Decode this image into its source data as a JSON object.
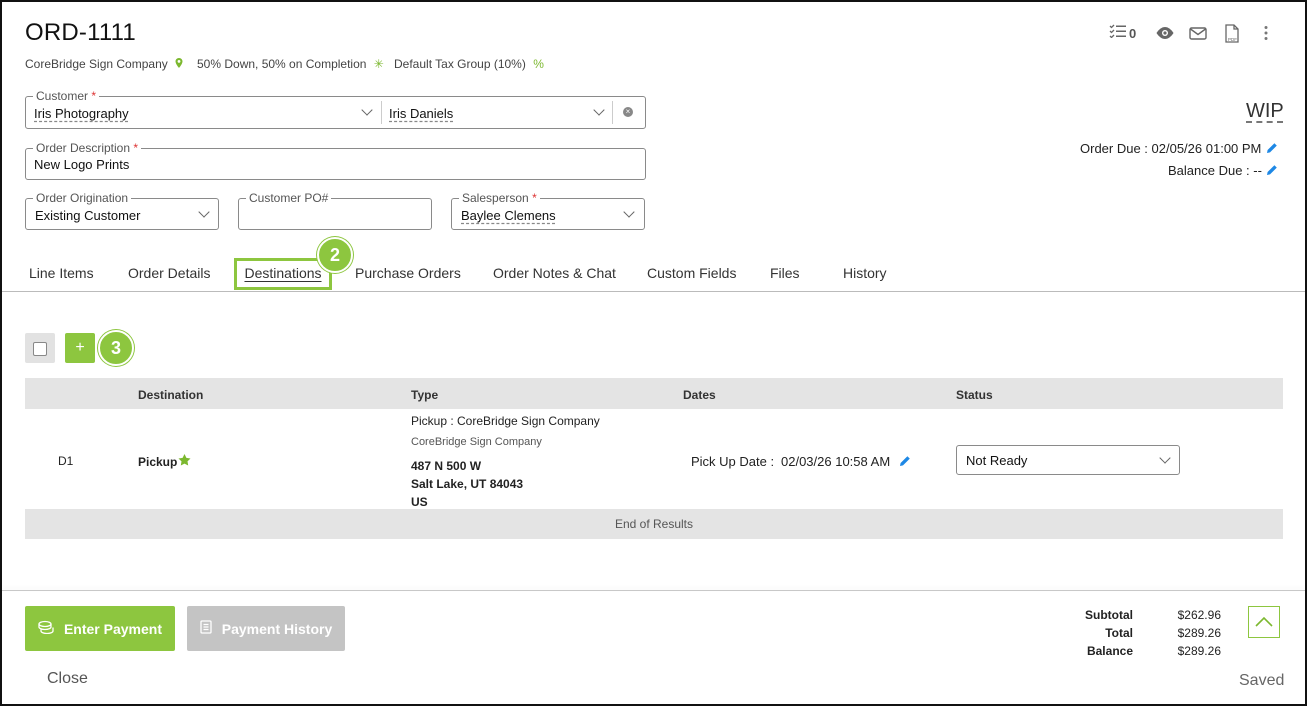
{
  "header": {
    "order_number": "ORD-1111",
    "company": "CoreBridge Sign Company",
    "payment_terms": "50% Down, 50% on Completion",
    "tax_group": "Default Tax Group (10%)",
    "task_count": "0",
    "status": "WIP",
    "order_due": "Order Due : 02/05/26 01:00 PM",
    "balance_due": "Balance Due : --"
  },
  "form": {
    "customer_label": "Customer",
    "customer_value": "Iris Photography",
    "contact_value": "Iris Daniels",
    "description_label": "Order Description",
    "description_value": "New Logo Prints",
    "origination_label": "Order Origination",
    "origination_value": "Existing Customer",
    "po_label": "Customer PO#",
    "po_value": "",
    "salesperson_label": "Salesperson",
    "salesperson_value": "Baylee Clemens",
    "required_mark": "*"
  },
  "tabs": [
    {
      "label": "Line Items"
    },
    {
      "label": "Order Details"
    },
    {
      "label": "Destinations"
    },
    {
      "label": "Purchase Orders"
    },
    {
      "label": "Order Notes & Chat"
    },
    {
      "label": "Custom Fields"
    },
    {
      "label": "Files"
    },
    {
      "label": "History"
    }
  ],
  "callouts": {
    "tab_badge": "2",
    "add_badge": "3"
  },
  "toolbar": {
    "add_label": "+"
  },
  "table": {
    "columns": [
      "Destination",
      "Type",
      "Dates",
      "Status"
    ],
    "rows": [
      {
        "id": "D1",
        "destination": "Pickup",
        "type_line": "Pickup : CoreBridge Sign Company",
        "type_company": "CoreBridge Sign Company",
        "addr1": "487 N 500 W",
        "addr2": "Salt Lake, UT 84043",
        "addr3": "US",
        "date_label": "Pick Up Date :",
        "date_value": "02/03/26 10:58 AM",
        "status": "Not Ready"
      }
    ],
    "end_text": "End of Results"
  },
  "footer": {
    "enter_payment": "Enter Payment",
    "payment_history": "Payment History",
    "close": "Close",
    "saved": "Saved",
    "subtotal_label": "Subtotal",
    "subtotal_value": "$262.96",
    "total_label": "Total",
    "total_value": "$289.26",
    "balance_label": "Balance",
    "balance_value": "$289.26"
  },
  "colors": {
    "accent": "#8dc63f",
    "link_blue": "#1e88e5",
    "disabled": "#c4c4c4"
  }
}
